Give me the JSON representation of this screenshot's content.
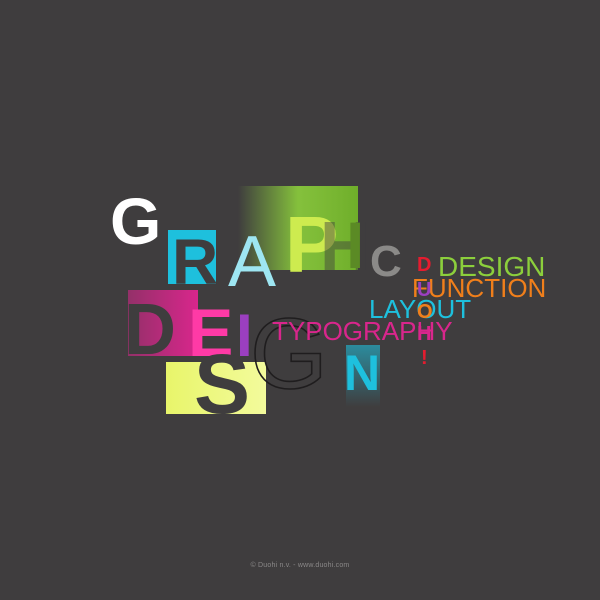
{
  "artwork": {
    "title_word_1": {
      "letters": [
        "G",
        "R",
        "A",
        "P",
        "H",
        "I",
        "C"
      ]
    },
    "title_word_2": {
      "letters": [
        "D",
        "E",
        "S",
        "I",
        "G",
        "N"
      ]
    },
    "terms": {
      "design": "DESIGN",
      "function": "FUNCTION",
      "layout": "LAYOUT",
      "typography": "TYPOGRAPHY",
      "vertical_letters": [
        "D",
        "U",
        "O",
        "H",
        "!"
      ]
    },
    "colors": {
      "background": "#3f3d3e",
      "white": "#ffffff",
      "cyan": "#1ec0dd",
      "green": "#8ccf3c",
      "magenta": "#d9268c",
      "purple": "#9b3fc0",
      "yellow": "#e8f56a",
      "orange": "#f07f1b",
      "red": "#e41c2f"
    }
  },
  "footer": {
    "credit": "© Duohi n.v. - www.duohi.com"
  }
}
